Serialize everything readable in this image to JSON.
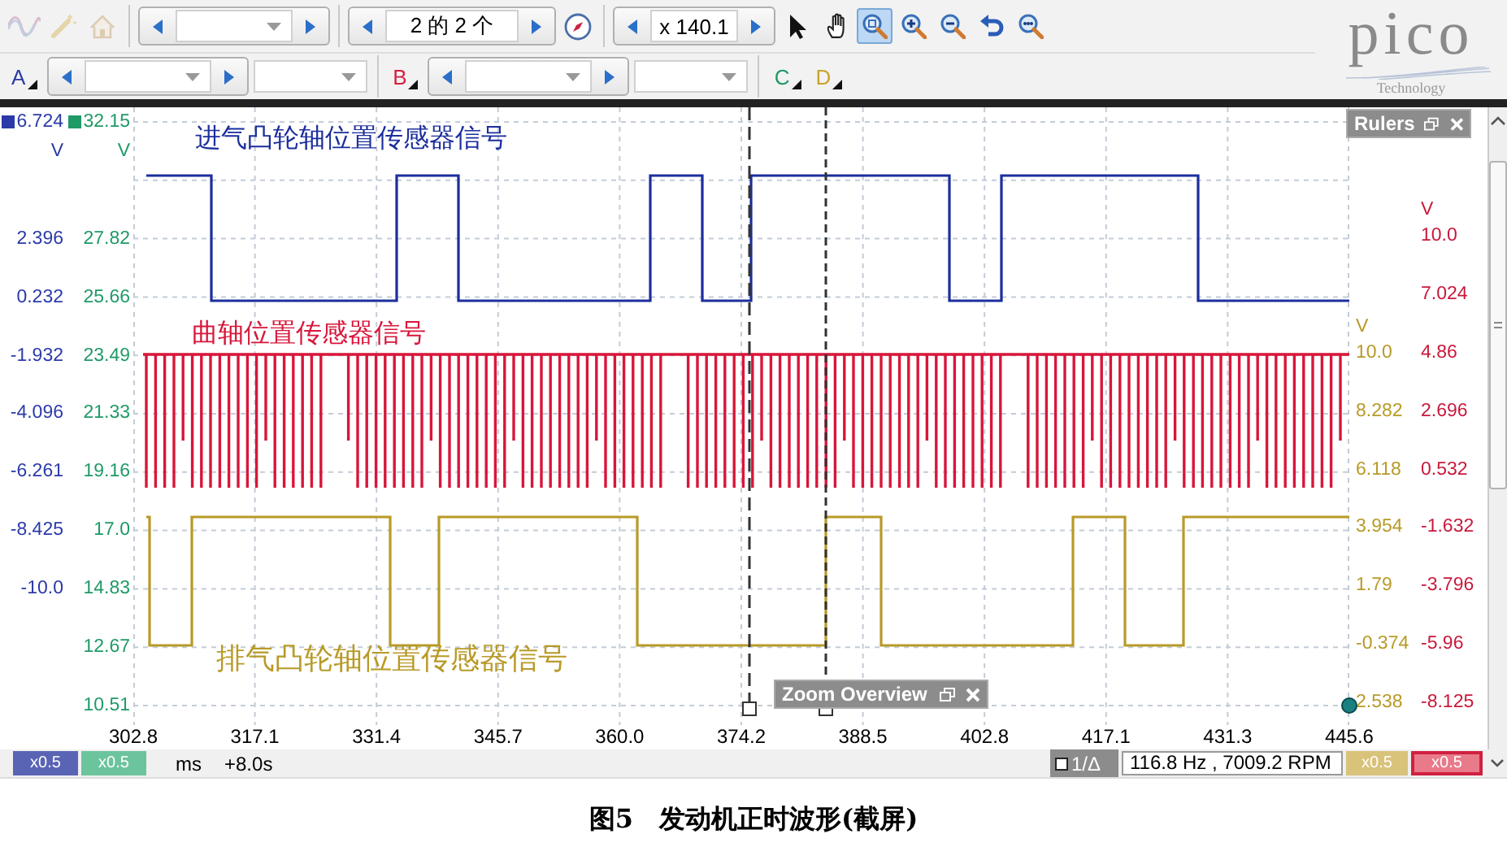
{
  "toolbar": {
    "tools": [
      {
        "kind": "waveform",
        "selected": false,
        "disabled": true
      },
      {
        "kind": "wand",
        "selected": false,
        "disabled": true
      },
      {
        "kind": "home",
        "selected": false,
        "disabled": true
      },
      {
        "kind": "pointer",
        "selected": false,
        "disabled": false
      },
      {
        "kind": "hand",
        "selected": false,
        "disabled": false
      },
      {
        "kind": "zoom",
        "selected": true,
        "disabled": false
      },
      {
        "kind": "zoom-in",
        "selected": false,
        "disabled": false
      },
      {
        "kind": "zoom-out",
        "selected": false,
        "disabled": false
      },
      {
        "kind": "undo",
        "selected": false,
        "disabled": false
      },
      {
        "kind": "zoom-fit",
        "selected": false,
        "disabled": false
      }
    ],
    "buffer_field": {
      "value": "2 的 2 个"
    },
    "zoom_field": {
      "value": "x 140.1"
    }
  },
  "logo": {
    "name": "pico",
    "tagline": "Technology"
  },
  "channels": [
    {
      "label": "A",
      "color": "#2b3aa8"
    },
    {
      "label": "B",
      "color": "#d4213f"
    },
    {
      "label": "C",
      "color": "#1f9a66"
    },
    {
      "label": "D",
      "color": "#c9a227"
    }
  ],
  "axes": {
    "left": [
      {
        "color": "#2b3aa8",
        "unit": "V",
        "ticks": [
          "6.724",
          "2.396",
          "0.232",
          "-1.932",
          "-4.096",
          "-6.261",
          "-8.425",
          "-10.0"
        ]
      },
      {
        "color": "#1f9a66",
        "unit": "V",
        "ticks": [
          "32.15",
          "27.82",
          "25.66",
          "23.49",
          "21.33",
          "19.16",
          "17.0",
          "14.83",
          "12.67",
          "10.51"
        ]
      }
    ],
    "right": [
      {
        "color": "#b89a28",
        "unit": "V",
        "ticks": [
          "10.0",
          "8.282",
          "6.118",
          "3.954",
          "1.79",
          "-0.374",
          "2.538"
        ]
      },
      {
        "color": "#c8193c",
        "unit": "V",
        "ticks": [
          "10.0",
          "7.024",
          "4.86",
          "2.696",
          "0.532",
          "-1.632",
          "-3.796",
          "-5.96",
          "-8.125"
        ]
      }
    ]
  },
  "x_axis": {
    "labels": [
      "302.8",
      "317.1",
      "331.4",
      "345.7",
      "360.0",
      "374.2",
      "388.5",
      "402.8",
      "417.1",
      "431.3",
      "445.6"
    ]
  },
  "traces": [
    {
      "kind": "square",
      "label": "进气凸轮轴位置传感器信号",
      "color": "#1c2e9c"
    },
    {
      "kind": "pulses",
      "label": "曲轴位置传感器信号",
      "color": "#d8163a"
    },
    {
      "kind": "square",
      "label": "排气凸轮轴位置传感器信号",
      "color": "#b89a28"
    }
  ],
  "rulers_panel": {
    "title": "Rulers"
  },
  "zoom_overview": {
    "title": "Zoom Overview"
  },
  "status_bar": {
    "scales": [
      {
        "text": "x0.5",
        "color": "#5a64b4"
      },
      {
        "text": "x0.5",
        "color": "#6cc49c"
      }
    ],
    "unit": "ms",
    "offset": "+8.0s",
    "measure_label": "1/Δ",
    "measure": "116.8 Hz , 7009.2 RPM",
    "right_scales": [
      {
        "text": "x0.5",
        "color": "#d9c27a"
      },
      {
        "text": "x0.5",
        "color": "#e87a8a"
      }
    ]
  },
  "caption": "图5　发动机正时波形(截屏)"
}
